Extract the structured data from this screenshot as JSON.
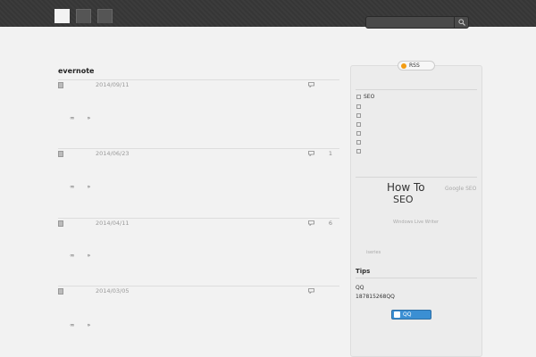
{
  "nav": {
    "tabs": [
      {
        "label": ""
      },
      {
        "label": ""
      },
      {
        "label": ""
      }
    ]
  },
  "search": {
    "placeholder": ""
  },
  "site": {
    "title": "",
    "description": ""
  },
  "posts": [
    {
      "title": "evernote",
      "author": "",
      "date": "2014/09/11",
      "comments": "",
      "excerpt": "",
      "more": "»"
    },
    {
      "title": "",
      "author": "",
      "date": "2014/06/23",
      "comments": "1",
      "excerpt": "",
      "more": "»"
    },
    {
      "title": "",
      "author": "",
      "date": "2014/04/11",
      "comments": "6",
      "excerpt": "",
      "more": "»"
    },
    {
      "title": "",
      "author": "",
      "date": "2014/03/05",
      "comments": "",
      "excerpt": "",
      "more": "»"
    },
    {
      "title": "",
      "author": "",
      "date": "",
      "comments": "",
      "excerpt": "",
      "more": ""
    }
  ],
  "sidebar": {
    "rss_label": "RSS",
    "categories_heading": "",
    "categories": [
      "SEO",
      "",
      "",
      "",
      "",
      "",
      ""
    ],
    "tags_heading": "",
    "tags": [
      "",
      "How To",
      "",
      "Google SEO",
      "SEO",
      "",
      "",
      "",
      "",
      "",
      "Windows Live Writer",
      "",
      "",
      "",
      "",
      "",
      "",
      "",
      "iseries"
    ],
    "tips_heading": "Tips",
    "tips_text_1": "QQ",
    "tips_text_2": "187815268QQ",
    "qq_button": "QQ",
    "tips_text_3": ""
  },
  "colors": {
    "topbar": "#3a3a3a",
    "background": "#f2f2f2",
    "sidebar": "#ececec",
    "qq_button": "#3b8fd3"
  }
}
